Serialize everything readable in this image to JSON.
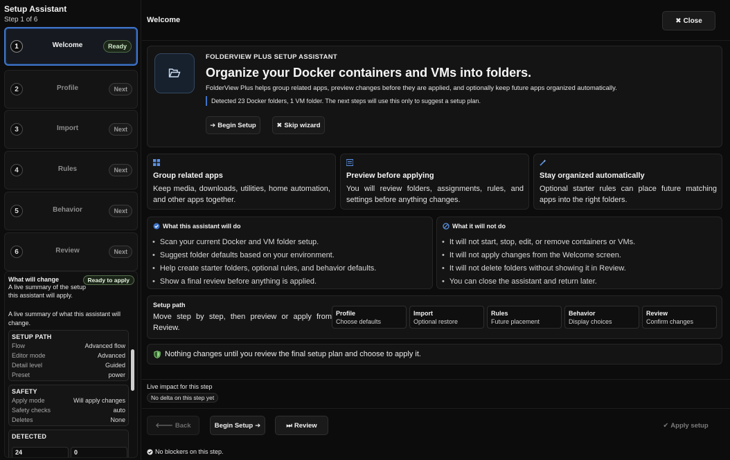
{
  "sidebar": {
    "title": "Setup Assistant",
    "step_counter": "Step 1 of 6",
    "steps": [
      {
        "num": "1",
        "label": "Welcome",
        "status": "Ready"
      },
      {
        "num": "2",
        "label": "Profile",
        "status": "Next"
      },
      {
        "num": "3",
        "label": "Import",
        "status": "Next"
      },
      {
        "num": "4",
        "label": "Rules",
        "status": "Next"
      },
      {
        "num": "5",
        "label": "Behavior",
        "status": "Next"
      },
      {
        "num": "6",
        "label": "Review",
        "status": "Next"
      }
    ],
    "what_will_change": {
      "title": "What will change",
      "badge": "Ready to apply",
      "desc": "A live summary of the setup this assistant will apply.",
      "desc2": "A live summary of what this assistant will change.",
      "setup_path": {
        "title": "SETUP PATH",
        "rows": [
          {
            "k": "Flow",
            "v": "Advanced flow"
          },
          {
            "k": "Editor mode",
            "v": "Advanced"
          },
          {
            "k": "Detail level",
            "v": "Guided"
          },
          {
            "k": "Preset",
            "v": "power"
          }
        ]
      },
      "safety": {
        "title": "SAFETY",
        "rows": [
          {
            "k": "Apply mode",
            "v": "Will apply changes"
          },
          {
            "k": "Safety checks",
            "v": "auto"
          },
          {
            "k": "Deletes",
            "v": "None"
          }
        ]
      },
      "detected": {
        "title": "DETECTED",
        "docker": "24",
        "vm": "0"
      }
    }
  },
  "main": {
    "title": "Welcome",
    "close_label": "Close",
    "hero": {
      "kicker": "FOLDERVIEW PLUS SETUP ASSISTANT",
      "heading": "Organize your Docker containers and VMs into folders.",
      "desc": "FolderView Plus helps group related apps, preview changes before they are applied, and optionally keep future apps organized automatically.",
      "note": "Detected 23 Docker folders, 1 VM folder. The next steps will use this only to suggest a setup plan.",
      "begin_label": "Begin Setup",
      "skip_label": "Skip wizard"
    },
    "features": [
      {
        "title": "Group related apps",
        "text": "Keep media, downloads, utilities, home automation, and other apps together."
      },
      {
        "title": "Preview before applying",
        "text": "You will review folders, assignments, rules, and settings before anything changes."
      },
      {
        "title": "Stay organized automatically",
        "text": "Optional starter rules can place future matching apps into the right folders."
      }
    ],
    "will_do": {
      "title": "What this assistant will do",
      "items": [
        "Scan your current Docker and VM folder setup.",
        "Suggest folder defaults based on your environment.",
        "Help create starter folders, optional rules, and behavior defaults.",
        "Show a final review before anything is applied."
      ]
    },
    "will_not_do": {
      "title": "What it will not do",
      "items": [
        "It will not start, stop, edit, or remove containers or VMs.",
        "It will not apply changes from the Welcome screen.",
        "It will not delete folders without showing it in Review.",
        "You can close the assistant and return later."
      ]
    },
    "setup_path": {
      "title": "Setup path",
      "desc": "Move step by step, then preview or apply from Review.",
      "chips": [
        {
          "title": "Profile",
          "sub": "Choose defaults"
        },
        {
          "title": "Import",
          "sub": "Optional restore"
        },
        {
          "title": "Rules",
          "sub": "Future placement"
        },
        {
          "title": "Behavior",
          "sub": "Display choices"
        },
        {
          "title": "Review",
          "sub": "Confirm changes"
        }
      ]
    },
    "notice": "Nothing changes until you review the final setup plan and choose to apply it.",
    "live": {
      "title": "Live impact for this step",
      "chip": "No delta on this step yet"
    },
    "footer": {
      "back_label": "Back",
      "begin_label": "Begin Setup",
      "review_label": "Review",
      "apply_label": "Apply setup",
      "status": "No blockers on this step."
    }
  },
  "colors": {
    "accent": "#3f74c9",
    "ready": "#4e6a48",
    "background": "#0b0b0b",
    "panel": "#141414"
  }
}
